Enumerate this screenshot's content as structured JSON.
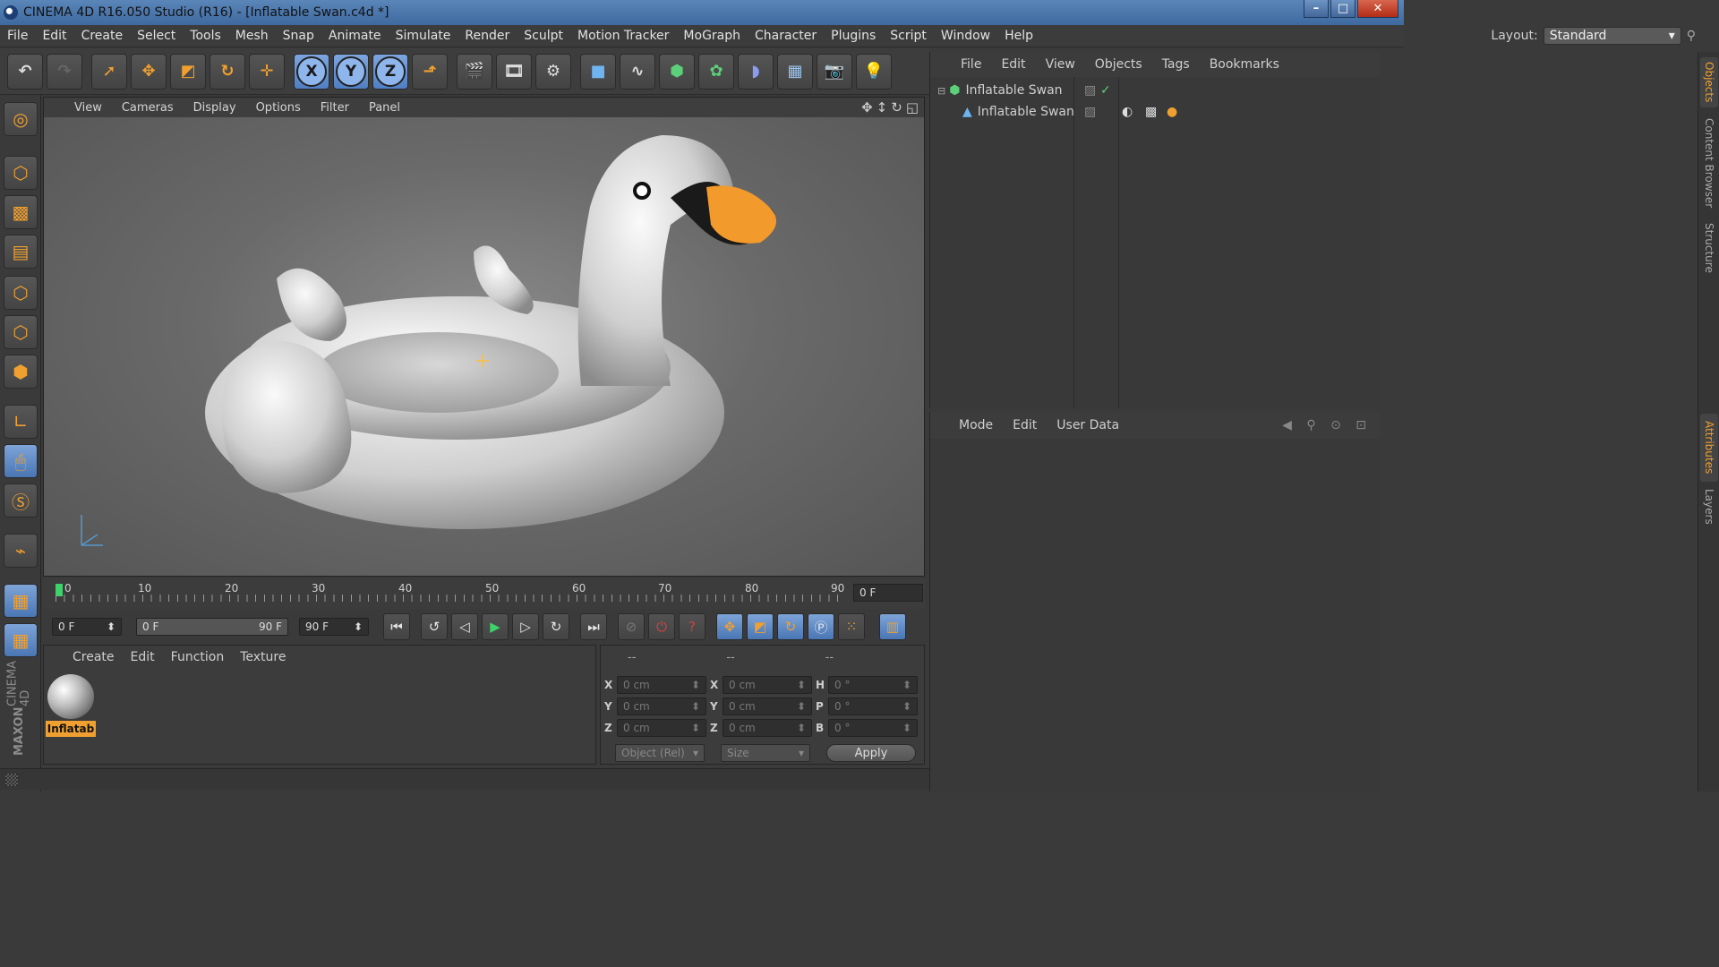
{
  "window": {
    "title": "CINEMA 4D R16.050 Studio (R16) - [Inflatable Swan.c4d *]"
  },
  "menu": [
    "File",
    "Edit",
    "Create",
    "Select",
    "Tools",
    "Mesh",
    "Snap",
    "Animate",
    "Simulate",
    "Render",
    "Sculpt",
    "Motion Tracker",
    "MoGraph",
    "Character",
    "Plugins",
    "Script",
    "Window",
    "Help"
  ],
  "layout": {
    "label": "Layout:",
    "value": "Standard"
  },
  "axes": [
    "X",
    "Y",
    "Z"
  ],
  "viewport": {
    "menu": [
      "View",
      "Cameras",
      "Display",
      "Options",
      "Filter",
      "Panel"
    ]
  },
  "timeline": {
    "ticks": [
      "0",
      "10",
      "20",
      "30",
      "40",
      "50",
      "60",
      "70",
      "80",
      "90"
    ],
    "current_frame": "0 F"
  },
  "playback": {
    "start": "0 F",
    "range_start": "0 F",
    "range_end": "90 F",
    "end": "90 F"
  },
  "material_manager": {
    "menu": [
      "Create",
      "Edit",
      "Function",
      "Texture"
    ],
    "material_name": "Inflatab"
  },
  "coordinates": {
    "headers": [
      "--",
      "--",
      "--"
    ],
    "pos": [
      {
        "axis": "X",
        "value": "0 cm"
      },
      {
        "axis": "Y",
        "value": "0 cm"
      },
      {
        "axis": "Z",
        "value": "0 cm"
      }
    ],
    "size": [
      {
        "axis": "X",
        "value": "0 cm"
      },
      {
        "axis": "Y",
        "value": "0 cm"
      },
      {
        "axis": "Z",
        "value": "0 cm"
      }
    ],
    "rot": [
      {
        "axis": "H",
        "value": "0 °"
      },
      {
        "axis": "P",
        "value": "0 °"
      },
      {
        "axis": "B",
        "value": "0 °"
      }
    ],
    "mode": "Object (Rel)",
    "size_mode": "Size",
    "apply": "Apply"
  },
  "object_manager": {
    "menu": [
      "File",
      "Edit",
      "View",
      "Objects",
      "Tags",
      "Bookmarks"
    ],
    "objects": [
      {
        "name": "Inflatable Swan"
      },
      {
        "name": "Inflatable Swan"
      }
    ]
  },
  "attribute_manager": {
    "menu": [
      "Mode",
      "Edit",
      "User Data"
    ]
  },
  "side_tabs": [
    "Objects",
    "Content Browser",
    "Structure",
    "Attributes",
    "Layers"
  ],
  "brand": {
    "line1": "MAXON",
    "line2": "CINEMA 4D"
  },
  "colors": {
    "accent": "#f0a030",
    "active_blue": "#6f97d0"
  }
}
